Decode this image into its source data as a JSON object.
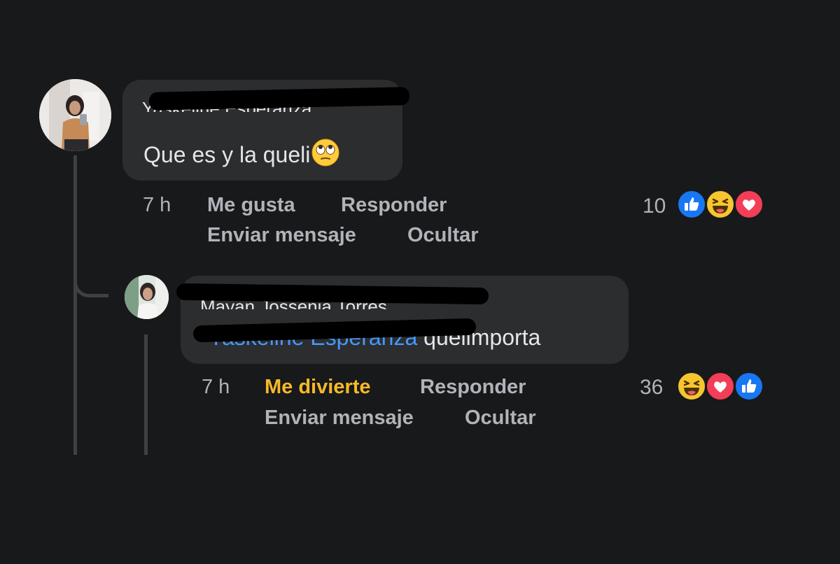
{
  "comments": [
    {
      "author": "Yaskeline Esperanza",
      "text": "Que es y la queli",
      "text_emoji": "face-with-rolling-eyes",
      "time": "7 h",
      "like_label": "Me gusta",
      "reply_label": "Responder",
      "message_label": "Enviar mensaje",
      "hide_label": "Ocultar",
      "reaction_count": "10",
      "reactions": [
        "like-icon",
        "haha-icon",
        "love-icon"
      ]
    }
  ],
  "replies": [
    {
      "author": "Mayan Jossenia Torres",
      "mention": "Yaskeline Esperanza",
      "text": " quelimporta",
      "time": "7 h",
      "reaction_label": "Me divierte",
      "reply_label": "Responder",
      "message_label": "Enviar mensaje",
      "hide_label": "Ocultar",
      "reaction_count": "36",
      "reactions": [
        "haha-icon",
        "love-icon",
        "like-icon"
      ]
    }
  ],
  "colors": {
    "background": "#18191b",
    "bubble": "#2c2d2f",
    "text": "#e4e6eb",
    "secondary_text": "#b0b3b8",
    "mention": "#4599ff",
    "haha_active": "#f7b928",
    "like_blue": "#1877f2",
    "love_red": "#f33e58"
  }
}
